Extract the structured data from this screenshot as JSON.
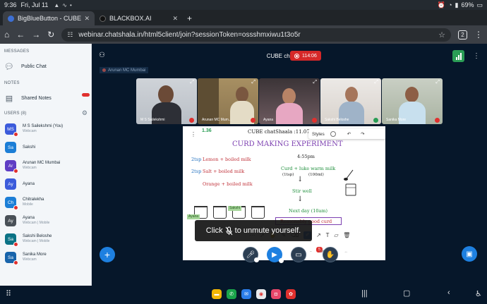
{
  "status_bar": {
    "time": "9:36",
    "date": "Fri, Jul 11",
    "battery": "69%"
  },
  "tabs": [
    {
      "title": "BigBlueButton - CUBE ch",
      "favicon_color": "#3d6fd3",
      "active": true
    },
    {
      "title": "BLACKBOX.AI",
      "favicon_color": "#111111",
      "active": false
    }
  ],
  "address": {
    "url": "webinar.chatshala.in/html5client/join?sessionToken=ossshmxiwu1t3o5r",
    "tab_count": "2"
  },
  "left_panel": {
    "messages_header": "MESSAGES",
    "public_chat": "Public Chat",
    "notes_header": "NOTES",
    "shared_notes": "Shared Notes",
    "users_header": "USERS (8)",
    "users": [
      {
        "initials": "MS",
        "name": "M S Sailekshmi (You)",
        "sub": "Webcam",
        "color": "#3b5bdb"
      },
      {
        "initials": "Sa",
        "name": "Sakshi",
        "sub": "",
        "color": "#1c7ed6"
      },
      {
        "initials": "Ar",
        "name": "Arunan MC Mumbai",
        "sub": "Webcam",
        "color": "#5f3dc4"
      },
      {
        "initials": "Ay",
        "name": "Ayana",
        "sub": "",
        "color": "#3b5bdb"
      },
      {
        "initials": "Ch",
        "name": "Chitralekha",
        "sub": "Mobile",
        "color": "#1c7ed6"
      },
      {
        "initials": "Ay",
        "name": "Ayana",
        "sub": "Webcam | Mobile",
        "color": "#495057"
      },
      {
        "initials": "Sa",
        "name": "Sakshi Beloshe",
        "sub": "Webcam | Mobile",
        "color": "#0b7285"
      },
      {
        "initials": "Sa",
        "name": "Sanika More",
        "sub": "Webcam",
        "color": "#1864ab"
      }
    ]
  },
  "header": {
    "room_title": "CUBE chatShaala",
    "recording_time": "114:06",
    "talking_indicator": "Arunan MC Mumbai"
  },
  "videos": [
    {
      "label": "M S Sailekshmi",
      "mic": "muted"
    },
    {
      "label": "Arunan MC Mum...",
      "mic": "muted"
    },
    {
      "label": "Ayana",
      "mic": "muted"
    },
    {
      "label": "Sakshi Beloshe",
      "mic": "on"
    },
    {
      "label": "Sanika More",
      "mic": "muted"
    }
  ],
  "whiteboard": {
    "page_number": "1.36",
    "title": "CUBE chatShaala :11.07.2025",
    "styles_label": "Styles",
    "heading": "CURD MAKING EXPERIMENT",
    "left_items": [
      {
        "qty": "2tsp",
        "text": "Lemon + boiled milk"
      },
      {
        "qty": "2tsp",
        "text": "Salt + boiled milk"
      },
      {
        "qty": "",
        "text": "Orange + boiled milk"
      }
    ],
    "time_note": "4:55pm",
    "mix": "Curd + luke warm milk",
    "tsp": "(1tsp)",
    "ml": "(100ml)",
    "stir": "Stir well",
    "next_day": "Next day (10am)",
    "result": "Reasonably good curd",
    "tag_left": "Ayana",
    "tag_right": "Sakshi",
    "zoom": "100%",
    "notif_count": "5"
  },
  "toast": {
    "before": "Click",
    "after": "to unmute yourself."
  }
}
